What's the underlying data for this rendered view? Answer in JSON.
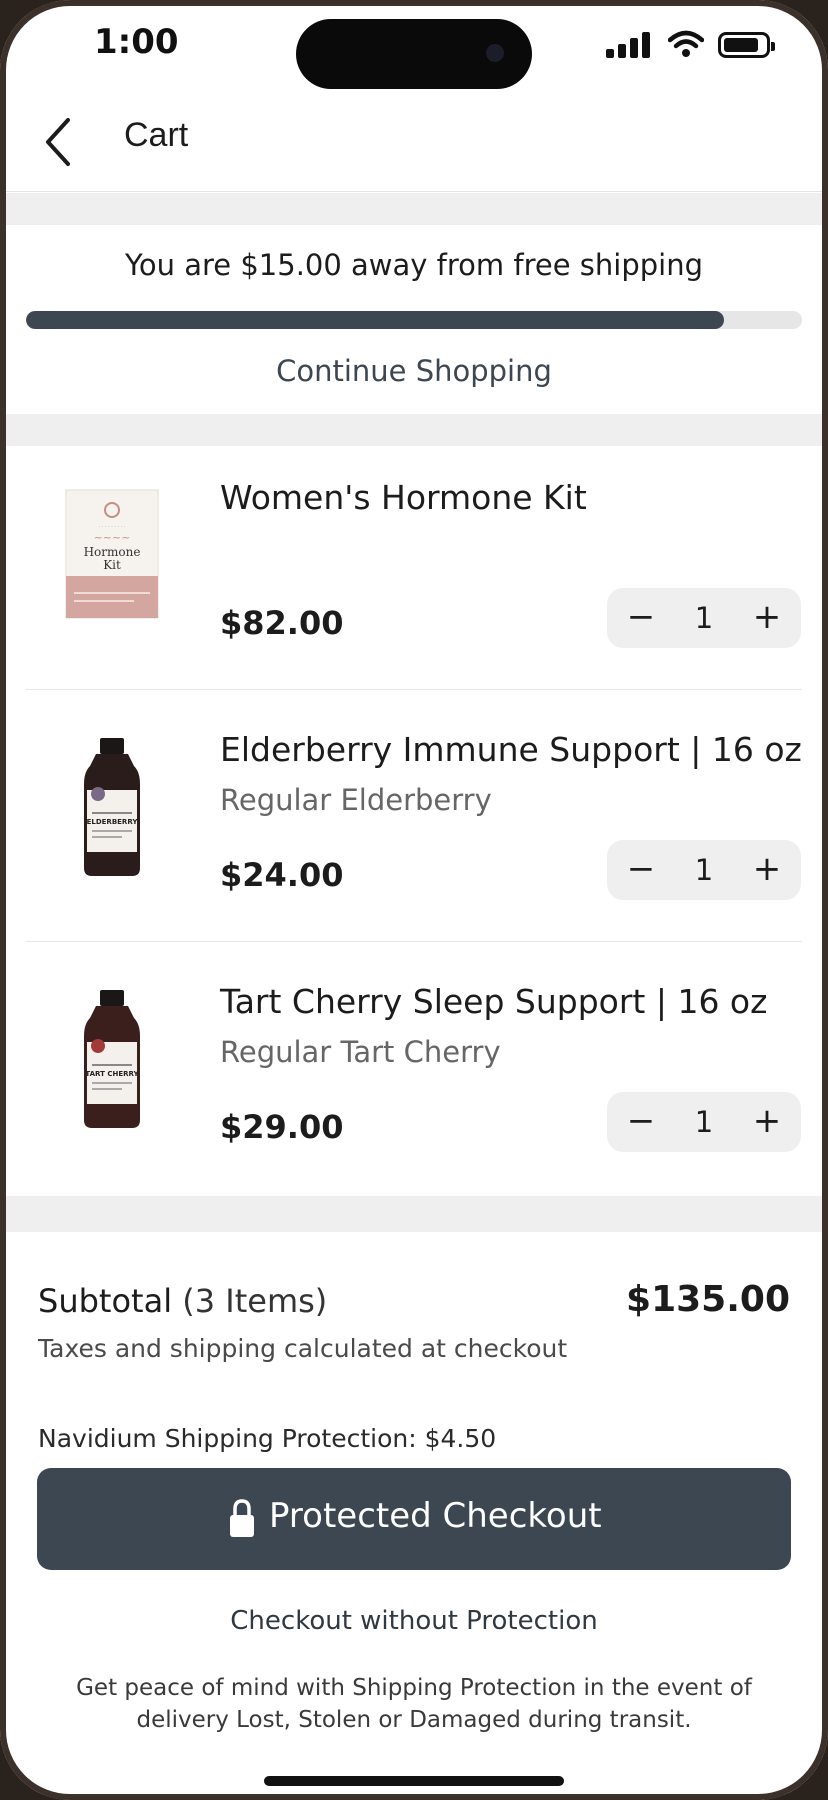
{
  "status_bar": {
    "time": "1:00"
  },
  "header": {
    "title": "Cart"
  },
  "shipping": {
    "message": "You are $15.00 away from free shipping",
    "progress_percent": 90,
    "continue_label": "Continue Shopping"
  },
  "items": [
    {
      "name": "Women's Hormone Kit",
      "variant": "",
      "price": "$82.00",
      "qty": "1",
      "thumb_icon": "hormone-kit-box"
    },
    {
      "name": "Elderberry Immune Support | 16 oz",
      "variant": "Regular Elderberry",
      "price": "$24.00",
      "qty": "1",
      "thumb_icon": "elderberry-bottle"
    },
    {
      "name": "Tart Cherry Sleep Support | 16 oz",
      "variant": "Regular Tart Cherry",
      "price": "$29.00",
      "qty": "1",
      "thumb_icon": "tart-cherry-bottle"
    }
  ],
  "stepper": {
    "minus": "−",
    "plus": "+"
  },
  "thumb_text": {
    "kit_line1": "Hormone",
    "kit_line2": "Kit",
    "bottle1": "ELDERBERRY",
    "bottle2": "TART CHERRY"
  },
  "summary": {
    "subtotal_label": "Subtotal",
    "subtotal_count": "(3 Items)",
    "subtotal_value": "$135.00",
    "tax_note": "Taxes and shipping calculated at checkout",
    "protection_fee": "Navidium Shipping Protection: $4.50",
    "checkout_label": "Protected Checkout",
    "no_protection_label": "Checkout without Protection",
    "disclaimer": "Get peace of mind with Shipping Protection in the event of delivery Lost, Stolen or Damaged during transit."
  },
  "colors": {
    "accent": "#3d4752",
    "separator": "#efefef",
    "stepper_bg": "#efefef"
  }
}
